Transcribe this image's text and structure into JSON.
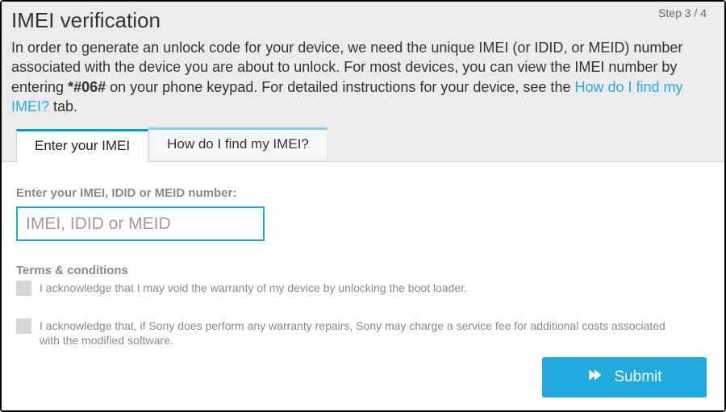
{
  "step_indicator": "Step 3 / 4",
  "page_title": "IMEI verification",
  "intro": {
    "part1": "In order to generate an unlock code for your device, we need the unique IMEI (or IDID, or MEID) number associated with the device you are about to unlock. For most devices, you can view the IMEI number by entering ",
    "code": "*#06#",
    "part2": " on your phone keypad. For detailed instructions for your device, see the ",
    "link_text": "How do I find my IMEI?",
    "part3": " tab."
  },
  "tabs": {
    "active": "Enter your IMEI",
    "inactive": "How do I find my IMEI?"
  },
  "form": {
    "field_label": "Enter your IMEI, IDID or MEID number:",
    "placeholder": "IMEI, IDID or MEID",
    "value": ""
  },
  "terms": {
    "heading": "Terms & conditions",
    "item1": "I acknowledge that I may void the warranty of my device by unlocking the boot loader.",
    "item2": "I acknowledge that, if Sony does perform any warranty repairs, Sony may charge a service fee for additional costs associated with the modified software."
  },
  "submit_label": "Submit"
}
